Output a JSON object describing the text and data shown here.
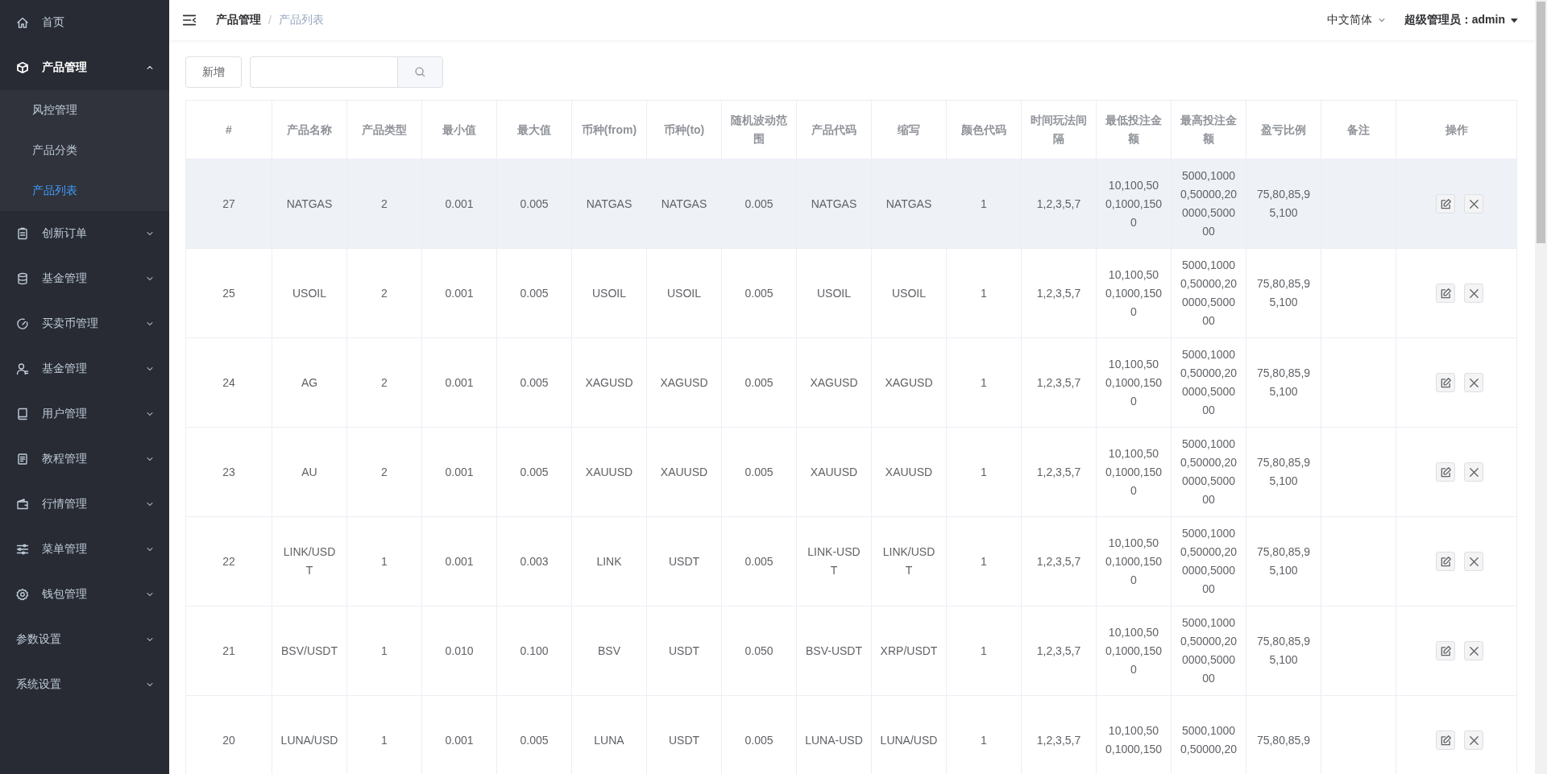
{
  "sidebar": {
    "items": [
      {
        "label": "首页",
        "kind": "icon",
        "selected": false
      },
      {
        "label": "产品管理",
        "kind": "icon",
        "selected": true,
        "expanded": true,
        "children": [
          {
            "label": "风控管理",
            "selected": false
          },
          {
            "label": "产品分类",
            "selected": false
          },
          {
            "label": "产品列表",
            "selected": true
          }
        ]
      },
      {
        "label": "创新订单",
        "kind": "icon",
        "selected": false,
        "expanded": false
      },
      {
        "label": "基金管理",
        "kind": "icon",
        "selected": false,
        "expanded": false
      },
      {
        "label": "买卖币管理",
        "kind": "icon",
        "selected": false,
        "expanded": false
      },
      {
        "label": "基金管理",
        "kind": "icon",
        "selected": false,
        "expanded": false
      },
      {
        "label": "用户管理",
        "kind": "icon",
        "selected": false,
        "expanded": false
      },
      {
        "label": "教程管理",
        "kind": "icon",
        "selected": false,
        "expanded": false
      },
      {
        "label": "行情管理",
        "kind": "icon",
        "selected": false,
        "expanded": false
      },
      {
        "label": "菜单管理",
        "kind": "icon",
        "selected": false,
        "expanded": false
      },
      {
        "label": "钱包管理",
        "kind": "icon",
        "selected": false,
        "expanded": false
      },
      {
        "label": "参数设置",
        "kind": "plain",
        "selected": false,
        "expanded": false
      },
      {
        "label": "系统设置",
        "kind": "plain",
        "selected": false,
        "expanded": false
      }
    ]
  },
  "header": {
    "breadcrumb": [
      "产品管理",
      "产品列表"
    ],
    "breadcrumb_separator": "/",
    "language": "中文简体",
    "user": "超级管理员：admin"
  },
  "toolbar": {
    "add_button": "新增"
  },
  "table": {
    "columns": [
      {
        "label": "#",
        "kind": "text"
      },
      {
        "label": "产品名称",
        "kind": "text"
      },
      {
        "label": "产品类型",
        "kind": "text"
      },
      {
        "label": "最小值",
        "kind": "text"
      },
      {
        "label": "最大值",
        "kind": "text"
      },
      {
        "label": "币种(from)",
        "kind": "text"
      },
      {
        "label": "币种(to)",
        "kind": "text"
      },
      {
        "label": "随机波动范围",
        "kind": "text"
      },
      {
        "label": "产品代码",
        "kind": "text"
      },
      {
        "label": "缩写",
        "kind": "text"
      },
      {
        "label": "颜色代码",
        "kind": "text"
      },
      {
        "label": "时间玩法间隔",
        "kind": "text"
      },
      {
        "label": "最低投注金额",
        "kind": "text"
      },
      {
        "label": "最高投注金额",
        "kind": "text"
      },
      {
        "label": "盈亏比例",
        "kind": "text"
      },
      {
        "label": "备注",
        "kind": "empty"
      },
      {
        "label": "操作",
        "kind": "actions"
      }
    ],
    "rows": [
      {
        "highlighted": true,
        "cells": [
          "27",
          "NATGAS",
          "2",
          "0.001",
          "0.005",
          "NATGAS",
          "NATGAS",
          "0.005",
          "NATGAS",
          "NATGAS",
          "1",
          "1,2,3,5,7",
          "10,100,500,1000,1500",
          "5000,10000,50000,200000,500000",
          "75,80,85,95,100"
        ]
      },
      {
        "highlighted": false,
        "cells": [
          "25",
          "USOIL",
          "2",
          "0.001",
          "0.005",
          "USOIL",
          "USOIL",
          "0.005",
          "USOIL",
          "USOIL",
          "1",
          "1,2,3,5,7",
          "10,100,500,1000,1500",
          "5000,10000,50000,200000,500000",
          "75,80,85,95,100"
        ]
      },
      {
        "highlighted": false,
        "cells": [
          "24",
          "AG",
          "2",
          "0.001",
          "0.005",
          "XAGUSD",
          "XAGUSD",
          "0.005",
          "XAGUSD",
          "XAGUSD",
          "1",
          "1,2,3,5,7",
          "10,100,500,1000,1500",
          "5000,10000,50000,200000,500000",
          "75,80,85,95,100"
        ]
      },
      {
        "highlighted": false,
        "cells": [
          "23",
          "AU",
          "2",
          "0.001",
          "0.005",
          "XAUUSD",
          "XAUUSD",
          "0.005",
          "XAUUSD",
          "XAUUSD",
          "1",
          "1,2,3,5,7",
          "10,100,500,1000,1500",
          "5000,10000,50000,200000,500000",
          "75,80,85,95,100"
        ]
      },
      {
        "highlighted": false,
        "cells": [
          "22",
          "LINK/USDT",
          "1",
          "0.001",
          "0.003",
          "LINK",
          "USDT",
          "0.005",
          "LINK-USDT",
          "LINK/USDT",
          "1",
          "1,2,3,5,7",
          "10,100,500,1000,1500",
          "5000,10000,50000,200000,500000",
          "75,80,85,95,100"
        ]
      },
      {
        "highlighted": false,
        "cells": [
          "21",
          "BSV/USDT",
          "1",
          "0.010",
          "0.100",
          "BSV",
          "USDT",
          "0.050",
          "BSV-USDT",
          "XRP/USDT",
          "1",
          "1,2,3,5,7",
          "10,100,500,1000,1500",
          "5000,10000,50000,200000,500000",
          "75,80,85,95,100"
        ]
      },
      {
        "highlighted": false,
        "cells": [
          "20",
          "LUNA/USD",
          "1",
          "0.001",
          "0.005",
          "LUNA",
          "USDT",
          "0.005",
          "LUNA-USD",
          "LUNA/USD",
          "1",
          "1,2,3,5,7",
          "10,100,500,1000,150",
          "5000,10000,50000,20",
          "75,80,85,9"
        ]
      }
    ]
  }
}
